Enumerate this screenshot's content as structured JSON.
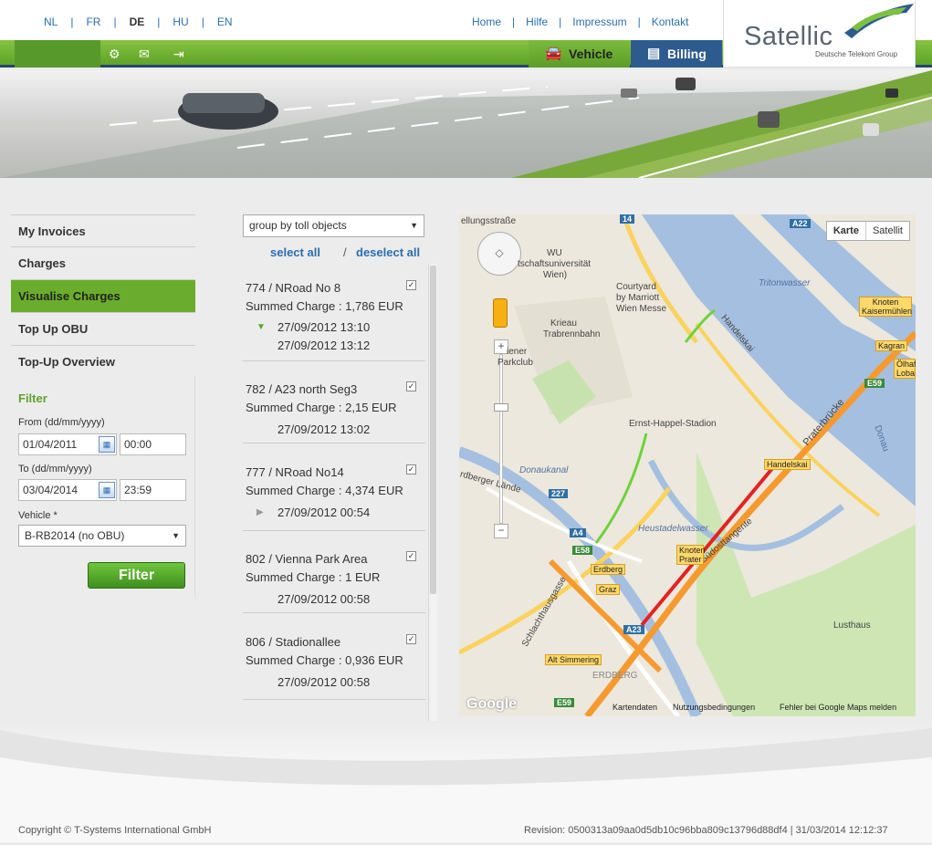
{
  "header": {
    "languages": [
      "NL",
      "FR",
      "DE",
      "HU",
      "EN"
    ],
    "active_language": "DE",
    "links": [
      "Home",
      "Hilfe",
      "Impressum",
      "Kontakt"
    ],
    "logo_text": "Satellic",
    "logo_sub": "Deutsche Telekom Group"
  },
  "nav": {
    "icons": [
      "gear-icon",
      "mail-icon",
      "logout-icon"
    ],
    "tabs": [
      {
        "label": "Vehicle",
        "icon": "car-icon"
      },
      {
        "label": "Billing",
        "icon": "document-icon"
      }
    ],
    "active_tab": "Billing"
  },
  "sidebar": {
    "items": [
      {
        "label": "My Invoices"
      },
      {
        "label": "Charges"
      },
      {
        "label": "Visualise Charges"
      },
      {
        "label": "Top Up OBU"
      },
      {
        "label": "Top-Up Overview"
      }
    ],
    "active_item": "Visualise Charges"
  },
  "filter": {
    "title": "Filter",
    "from_label": "From (dd/mm/yyyy)",
    "from_date": "01/04/2011",
    "from_time": "00:00",
    "to_label": "To (dd/mm/yyyy)",
    "to_date": "03/04/2014",
    "to_time": "23:59",
    "vehicle_label": "Vehicle *",
    "vehicle_value": "B-RB2014 (no OBU)",
    "button": "Filter"
  },
  "charges": {
    "group_by": "group by toll objects",
    "select_all": "select all",
    "sep": "/",
    "deselect_all": "deselect all",
    "summed_label": "Summed Charge :",
    "entries": [
      {
        "id": "774",
        "name": "NRoad No 8",
        "charge": "1,786 EUR",
        "times": [
          "27/09/2012 13:10",
          "27/09/2012 13:12"
        ],
        "expanded": true
      },
      {
        "id": "782",
        "name": "A23 north Seg3",
        "charge": "2,15 EUR",
        "times": [
          "27/09/2012 13:02"
        ],
        "expanded": null
      },
      {
        "id": "777",
        "name": "NRoad No14",
        "charge": "4,374 EUR",
        "times": [
          "27/09/2012 00:54"
        ],
        "expanded": false
      },
      {
        "id": "802",
        "name": "Vienna Park Area",
        "charge": "1 EUR",
        "times": [
          "27/09/2012 00:58"
        ],
        "expanded": null
      },
      {
        "id": "806",
        "name": "Stadionallee",
        "charge": "0,936 EUR",
        "times": [
          "27/09/2012 00:58"
        ],
        "expanded": null
      }
    ]
  },
  "map": {
    "type_buttons": [
      "Karte",
      "Satellit"
    ],
    "labels": [
      {
        "text": "ellungsstraße",
        "x": 0,
        "y": 0
      },
      {
        "text": "WU",
        "x": 0,
        "y": 0
      },
      {
        "text": "tschaftsuniversität",
        "x": 0,
        "y": 0
      },
      {
        "text": "Wien)",
        "x": 0,
        "y": 0
      },
      {
        "text": "Courtyard",
        "x": 0,
        "y": 0
      },
      {
        "text": "by Marriott",
        "x": 0,
        "y": 0
      },
      {
        "text": "Wien Messe",
        "x": 0,
        "y": 0
      },
      {
        "text": "Krieau",
        "x": 0,
        "y": 0
      },
      {
        "text": "Trabrennbahn",
        "x": 0,
        "y": 0
      },
      {
        "text": "iener",
        "x": 0,
        "y": 0
      },
      {
        "text": "Parkclub",
        "x": 0,
        "y": 0
      },
      {
        "text": "Ernst-Happel-Stadion",
        "x": 0,
        "y": 0
      },
      {
        "text": "Tritonwasser",
        "x": 0,
        "y": 0
      },
      {
        "text": "Handelskai",
        "x": 0,
        "y": 0
      },
      {
        "text": "Donau",
        "x": 0,
        "y": 0
      },
      {
        "text": "Praterbrücke",
        "x": 0,
        "y": 0
      },
      {
        "text": "Donaukanal",
        "x": 0,
        "y": 0
      },
      {
        "text": "rdberger Lände",
        "x": 0,
        "y": 0
      },
      {
        "text": "Heustadelwasser",
        "x": 0,
        "y": 0
      },
      {
        "text": "Schlachthausgasse",
        "x": 0,
        "y": 0
      },
      {
        "text": "Südosttangente",
        "x": 0,
        "y": 0
      },
      {
        "text": "Lusthaus",
        "x": 0,
        "y": 0
      },
      {
        "text": "ERDBERG",
        "x": 0,
        "y": 0
      }
    ],
    "boxes": [
      "Knoten Kaisermühlen",
      "Kagran",
      "Ölhaf Loba",
      "Handelskai",
      "Knoten Prater",
      "Erdberg",
      "Graz",
      "Alt Simmering"
    ],
    "shields": [
      "14",
      "A22",
      "E59",
      "227",
      "A4",
      "E58",
      "A23",
      "E59"
    ],
    "footer": [
      "Kartendaten",
      "Nutzungsbedingungen",
      "Fehler bei Google Maps melden"
    ],
    "google": "Google"
  },
  "footer": {
    "copyright": "Copyright © T-Systems International GmbH",
    "revision": "Revision: 0500313a09aa0d5db10c96bba809c13796d88df4   |   31/03/2014 12:12:37"
  }
}
